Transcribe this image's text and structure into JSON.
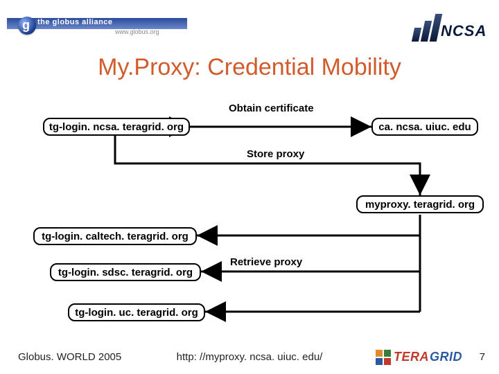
{
  "header": {
    "globus_text": "the globus alliance",
    "globus_url": "www.globus.org",
    "ncsa_text": "NCSA"
  },
  "title": "My.Proxy: Credential Mobility",
  "boxes": {
    "tg_ncsa": "tg-login. ncsa. teragrid. org",
    "ca": "ca. ncsa. uiuc. edu",
    "myproxy": "myproxy. teragrid. org",
    "tg_caltech": "tg-login. caltech. teragrid. org",
    "tg_sdsc": "tg-login. sdsc. teragrid. org",
    "tg_uc": "tg-login. uc. teragrid. org"
  },
  "labels": {
    "obtain": "Obtain certificate",
    "store": "Store proxy",
    "retrieve": "Retrieve proxy"
  },
  "footer": {
    "left": "Globus. WORLD 2005",
    "mid": "http: //myproxy. ncsa. uiuc. edu/",
    "num": "7",
    "teragrid_a": "TERA",
    "teragrid_b": "GRID"
  }
}
